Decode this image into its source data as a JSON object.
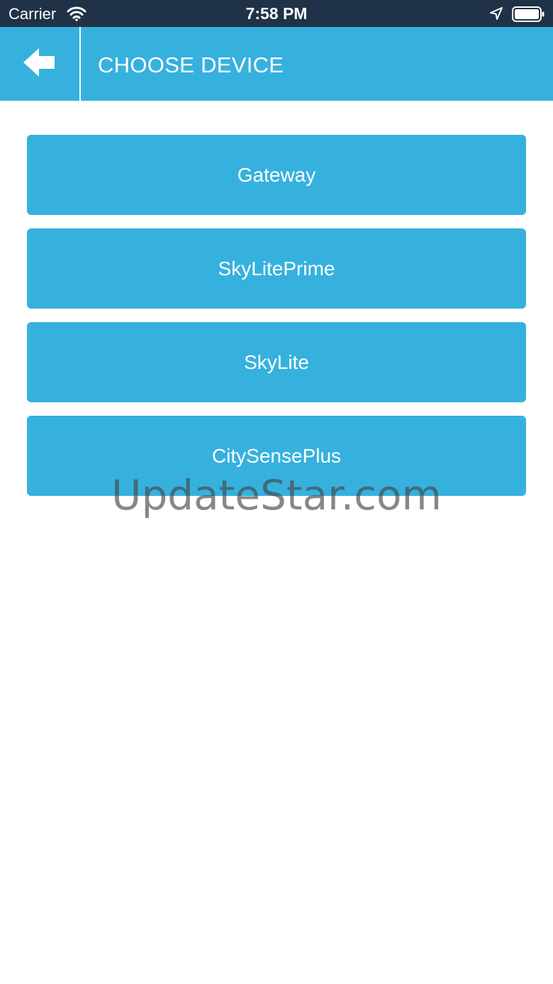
{
  "status_bar": {
    "carrier": "Carrier",
    "time": "7:58 PM",
    "icons": [
      "wifi-icon",
      "location-arrow-icon",
      "battery-icon"
    ]
  },
  "header": {
    "title": "CHOOSE DEVICE",
    "back_icon": "arrow-left-icon"
  },
  "devices": [
    {
      "label": "Gateway"
    },
    {
      "label": "SkyLitePrime"
    },
    {
      "label": "SkyLite"
    },
    {
      "label": "CitySensePlus"
    }
  ],
  "watermark": "UpdateStar.com",
  "colors": {
    "status_bar_bg": "#1f3247",
    "accent": "#36b1de",
    "text_on_accent": "#ffffff",
    "background": "#ffffff"
  }
}
